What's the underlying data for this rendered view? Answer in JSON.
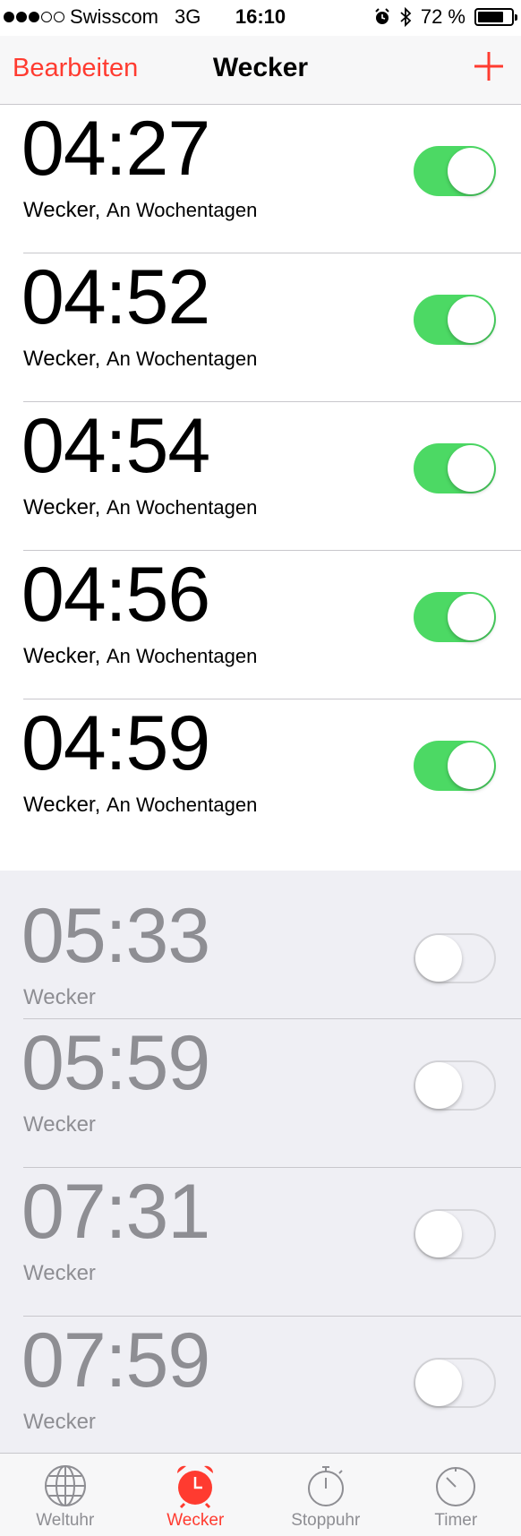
{
  "status_bar": {
    "carrier": "Swisscom",
    "network": "3G",
    "time": "16:10",
    "battery": "72 %",
    "battery_level": 0.72
  },
  "nav": {
    "edit_label": "Bearbeiten",
    "title": "Wecker",
    "add_icon": "plus-icon"
  },
  "alarms": [
    {
      "time": "04:27",
      "label": "Wecker,",
      "repeat": "An Wochentagen",
      "enabled": true
    },
    {
      "time": "04:52",
      "label": "Wecker,",
      "repeat": "An Wochentagen",
      "enabled": true
    },
    {
      "time": "04:54",
      "label": "Wecker,",
      "repeat": "An Wochentagen",
      "enabled": true
    },
    {
      "time": "04:56",
      "label": "Wecker,",
      "repeat": "An Wochentagen",
      "enabled": true
    },
    {
      "time": "04:59",
      "label": "Wecker,",
      "repeat": "An Wochentagen",
      "enabled": true
    },
    {
      "time": "05:33",
      "label": "Wecker",
      "repeat": "",
      "enabled": false
    },
    {
      "time": "05:59",
      "label": "Wecker",
      "repeat": "",
      "enabled": false
    },
    {
      "time": "07:31",
      "label": "Wecker",
      "repeat": "",
      "enabled": false
    },
    {
      "time": "07:59",
      "label": "Wecker",
      "repeat": "",
      "enabled": false
    }
  ],
  "tabs": [
    {
      "label": "Weltuhr",
      "icon": "globe-icon",
      "active": false
    },
    {
      "label": "Wecker",
      "icon": "alarm-clock-icon",
      "active": true
    },
    {
      "label": "Stoppuhr",
      "icon": "stopwatch-icon",
      "active": false
    },
    {
      "label": "Timer",
      "icon": "timer-icon",
      "active": false
    }
  ],
  "colors": {
    "accent": "#ff3b30",
    "toggle_on": "#4cd964",
    "inactive_text": "#8e8e93"
  }
}
